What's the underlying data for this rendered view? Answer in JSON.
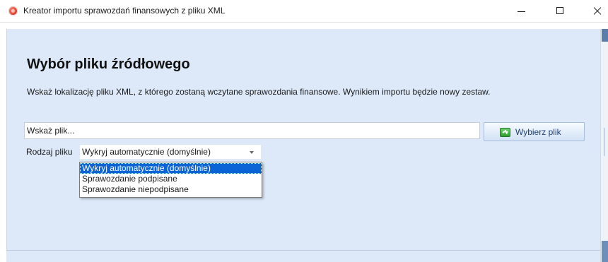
{
  "window": {
    "title": "Kreator importu sprawozdań finansowych z pliku XML",
    "app_icon": "app-logo-icon",
    "controls": [
      "minimize-icon",
      "maximize-icon",
      "close-icon"
    ]
  },
  "main": {
    "heading": "Wybór pliku źródłowego",
    "description": "Wskaż lokalizację pliku XML, z którego zostaną wczytane sprawozdania finansowe. Wynikiem importu będzie nowy zestaw.",
    "file_input": {
      "value": "",
      "placeholder": "Wskaż plik..."
    },
    "choose_button": {
      "label": "Wybierz plik",
      "icon": "arrow-export-icon"
    },
    "file_type": {
      "label": "Rodzaj pliku",
      "selected": "Wykryj automatycznie (domyślnie)",
      "options": [
        "Wykryj automatycznie (domyślnie)",
        "Sprawozdanie podpisane",
        "Sprawozdanie niepodpisane"
      ],
      "highlighted_index": 0
    }
  },
  "colors": {
    "panel_background": "#dde9f8",
    "selection": "#0a64d6",
    "button_text": "#1e3f77",
    "icon_green": "#2e9e2c",
    "app_icon_red": "#e2412c"
  }
}
